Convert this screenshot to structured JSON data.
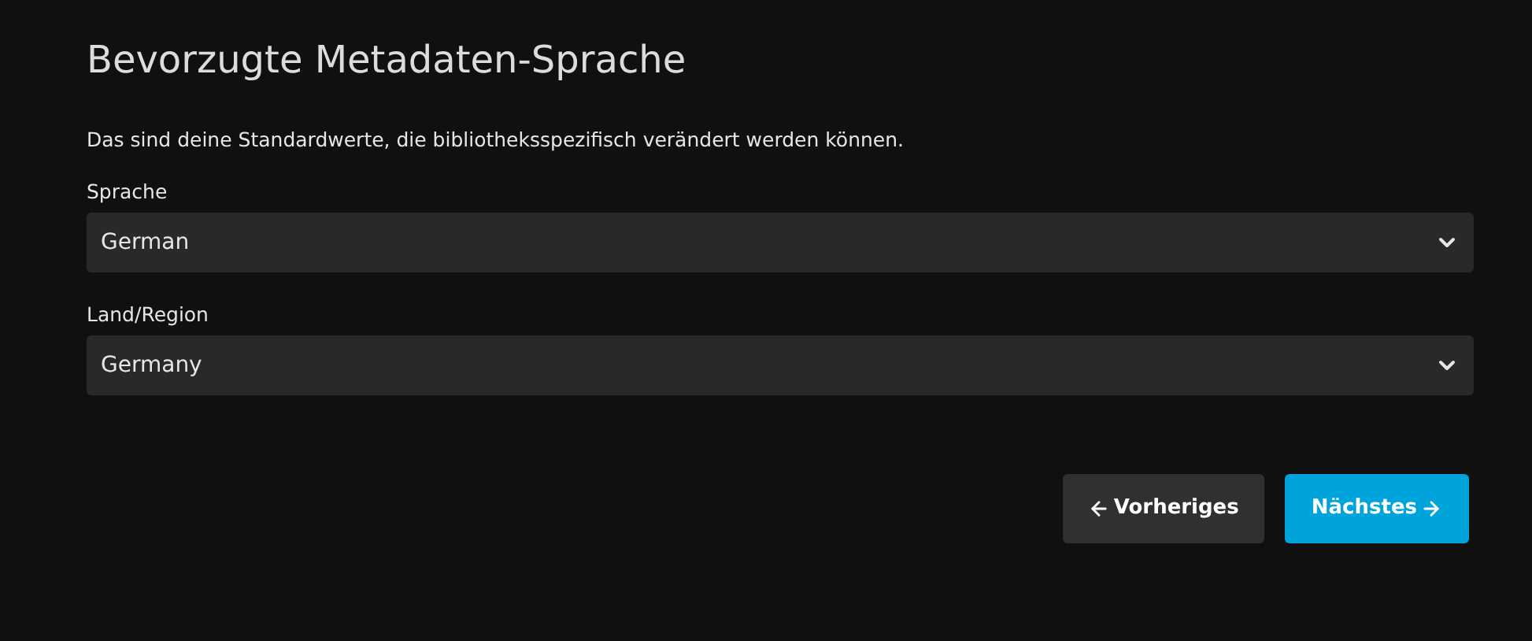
{
  "title": "Bevorzugte Metadaten-Sprache",
  "description": "Das sind deine Standardwerte, die bibliotheksspezifisch verändert werden können.",
  "fields": [
    {
      "label": "Sprache",
      "value": "German"
    },
    {
      "label": "Land/Region",
      "value": "Germany"
    }
  ],
  "buttons": [
    {
      "label": "Vorheriges",
      "kind": "secondary"
    },
    {
      "label": "Nächstes",
      "kind": "primary"
    }
  ]
}
